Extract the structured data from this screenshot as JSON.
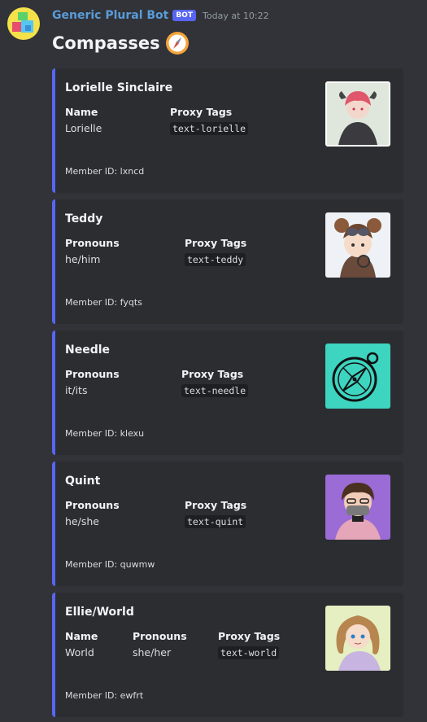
{
  "message": {
    "username": "Generic Plural Bot",
    "bot_tag": "BOT",
    "timestamp": "Today at 10:22",
    "title": "Compasses"
  },
  "cards": [
    {
      "name": "Lorielle Sinclaire",
      "fields": [
        {
          "label": "Name",
          "value": "Lorielle"
        },
        {
          "label": "Proxy Tags",
          "value": "text-lorielle",
          "code": true
        }
      ],
      "member_id": "Member ID: lxncd",
      "thumb_bg": "#dfe7dc"
    },
    {
      "name": "Teddy",
      "fields": [
        {
          "label": "Pronouns",
          "value": "he/him"
        },
        {
          "label": "Proxy Tags",
          "value": "text-teddy",
          "code": true
        }
      ],
      "member_id": "Member ID: fyqts",
      "thumb_bg": "#eef2f6"
    },
    {
      "name": "Needle",
      "fields": [
        {
          "label": "Pronouns",
          "value": "it/its"
        },
        {
          "label": "Proxy Tags",
          "value": "text-needle",
          "code": true
        }
      ],
      "member_id": "Member ID: klexu",
      "thumb_bg": "#3dd4c0"
    },
    {
      "name": "Quint",
      "fields": [
        {
          "label": "Pronouns",
          "value": "he/she"
        },
        {
          "label": "Proxy Tags",
          "value": "text-quint",
          "code": true
        }
      ],
      "member_id": "Member ID: quwmw",
      "thumb_bg": "#9b6bd6"
    },
    {
      "name": "Ellie/World",
      "fields": [
        {
          "label": "Name",
          "value": "World"
        },
        {
          "label": "Pronouns",
          "value": "she/her"
        },
        {
          "label": "Proxy Tags",
          "value": "text-world",
          "code": true
        }
      ],
      "member_id": "Member ID: ewfrt",
      "thumb_bg": "#e5efc2"
    }
  ],
  "colors": {
    "background": "#313338",
    "card": "#2b2d31",
    "accent": "#5865f2",
    "username": "#5a9bd8"
  },
  "icons": {
    "avatar": "cube-stack-icon",
    "title_emoji": "compass-icon"
  }
}
